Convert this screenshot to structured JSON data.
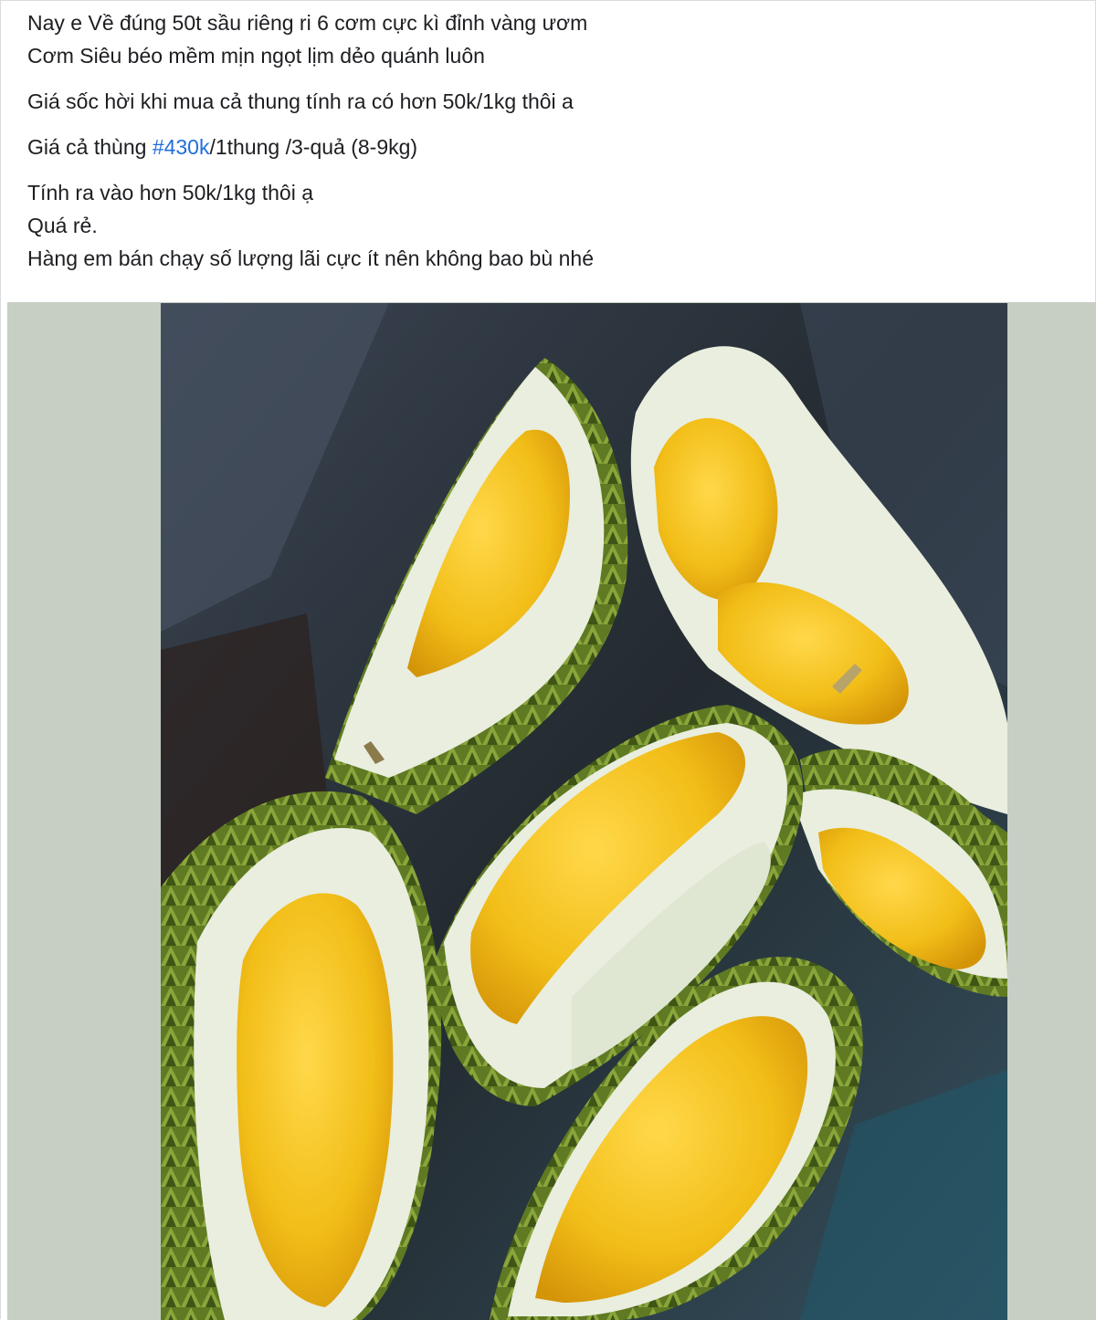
{
  "post": {
    "paragraphs": [
      {
        "lines": [
          "Nay e Về đúng 50t sầu riêng ri 6 cơm cực kì đỉnh vàng ươm",
          "Cơm Siêu béo mềm mịn ngọt lịm dẻo quánh luôn"
        ]
      },
      {
        "lines": [
          "Giá sốc hời khi mua cả thung tính ra có hơn 50k/1kg thôi a"
        ]
      },
      {
        "price_prefix": "Giá cả thùng ",
        "price_hashtag": "#430k",
        "price_suffix": "/1thung /3-quả (8-9kg)"
      },
      {
        "lines": [
          "Tính ra vào hơn 50k/1kg thôi ạ",
          "Quá rẻ.",
          "Hàng em bán chạy số lượng lãi cực ít nên không bao bù nhé"
        ]
      }
    ],
    "hashtag_color": "#216fdb",
    "text_color": "#1c1e21"
  },
  "media": {
    "subject": "durian-photo",
    "background_color": "#c7cfc4",
    "colors": {
      "flesh": "#f4c21a",
      "flesh_dark": "#d99b08",
      "rind_inner": "#e9eedf",
      "husk": "#6f8a2a",
      "husk_dark": "#3d4f16",
      "backdrop": "#2a323a"
    }
  }
}
